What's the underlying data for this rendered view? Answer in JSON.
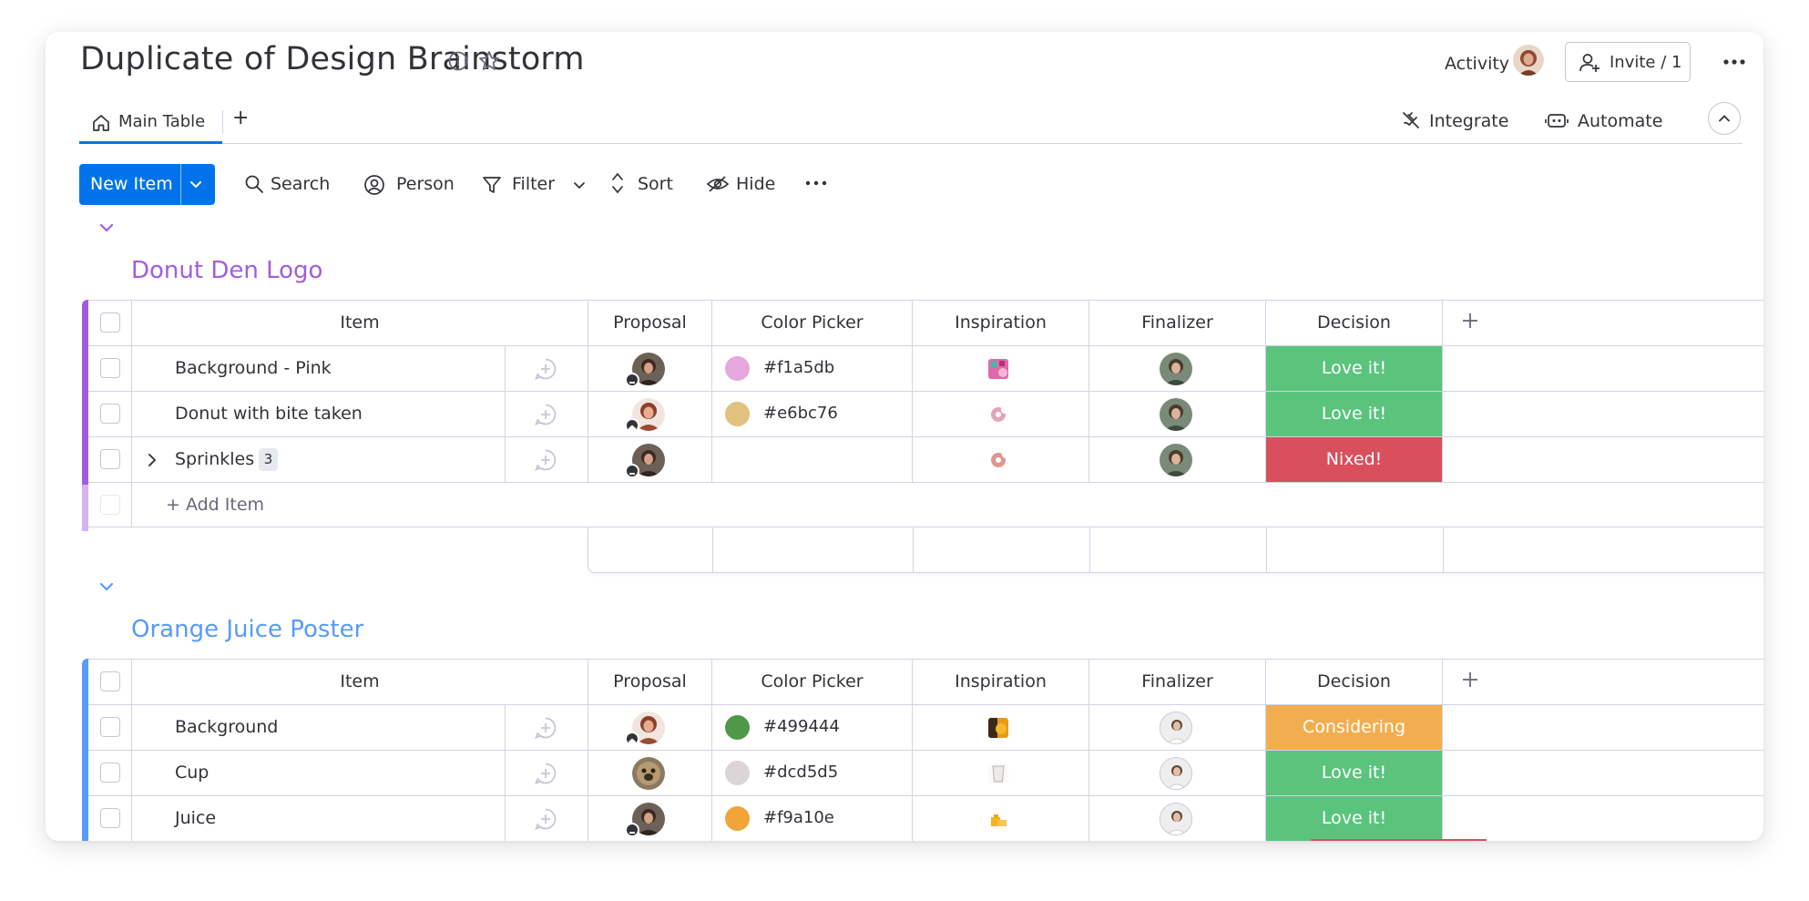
{
  "header": {
    "title": "Duplicate of Design Brainstorm",
    "activity_label": "Activity",
    "invite_label": "Invite / 1"
  },
  "tabs": {
    "main_table": "Main Table",
    "add": "+"
  },
  "top_actions": {
    "integrate": "Integrate",
    "automate": "Automate"
  },
  "toolbar": {
    "new_item": "New Item",
    "search": "Search",
    "person": "Person",
    "filter": "Filter",
    "sort": "Sort",
    "hide": "Hide"
  },
  "columns": {
    "item": "Item",
    "proposal": "Proposal",
    "color_picker": "Color Picker",
    "inspiration": "Inspiration",
    "finalizer": "Finalizer",
    "decision": "Decision"
  },
  "colors": {
    "primary": "#0073ea",
    "group1": "#a25ddc",
    "group2": "#579bfc",
    "love_it": "#00c875",
    "nixed": "#e2445c",
    "considering": "#fdab3d"
  },
  "groups": [
    {
      "title": "Donut Den Logo",
      "add_item": "+ Add Item",
      "rows": [
        {
          "item": "Background - Pink",
          "color": "#f1a5db",
          "hex": "#f1a5db",
          "decision": "Love it!",
          "decision_color": "#5ac47d",
          "badge": "minus",
          "inspiration": "pink-pattern-thumbnail"
        },
        {
          "item": "Donut with bite taken",
          "color": "#e6bc76",
          "hex": "#e6bc76",
          "decision": "Love it!",
          "decision_color": "#5ac47d",
          "badge": "home",
          "inspiration": "donut-thumbnail"
        },
        {
          "item": "Sprinkles",
          "count": "3",
          "color": "",
          "hex": "",
          "decision": "Nixed!",
          "decision_color": "#d94f5c",
          "badge": "minus",
          "inspiration": "donut-thumbnail"
        }
      ]
    },
    {
      "title": "Orange Juice Poster",
      "rows": [
        {
          "item": "Background",
          "color": "#499444",
          "hex": "#499444",
          "decision": "Considering",
          "decision_color": "#f2ae4e",
          "badge": "home",
          "inspiration": "orange-photo-thumbnail"
        },
        {
          "item": "Cup",
          "color": "#dcd5d5",
          "hex": "#dcd5d5",
          "decision": "Love it!",
          "decision_color": "#5ac47d",
          "badge": "",
          "inspiration": "cup-thumbnail"
        },
        {
          "item": "Juice",
          "color": "#f9a10e",
          "hex": "#f9a10e",
          "decision": "Love it!",
          "decision_color": "#5ac47d",
          "badge": "minus",
          "inspiration": "juice-thumbnail"
        }
      ]
    }
  ]
}
